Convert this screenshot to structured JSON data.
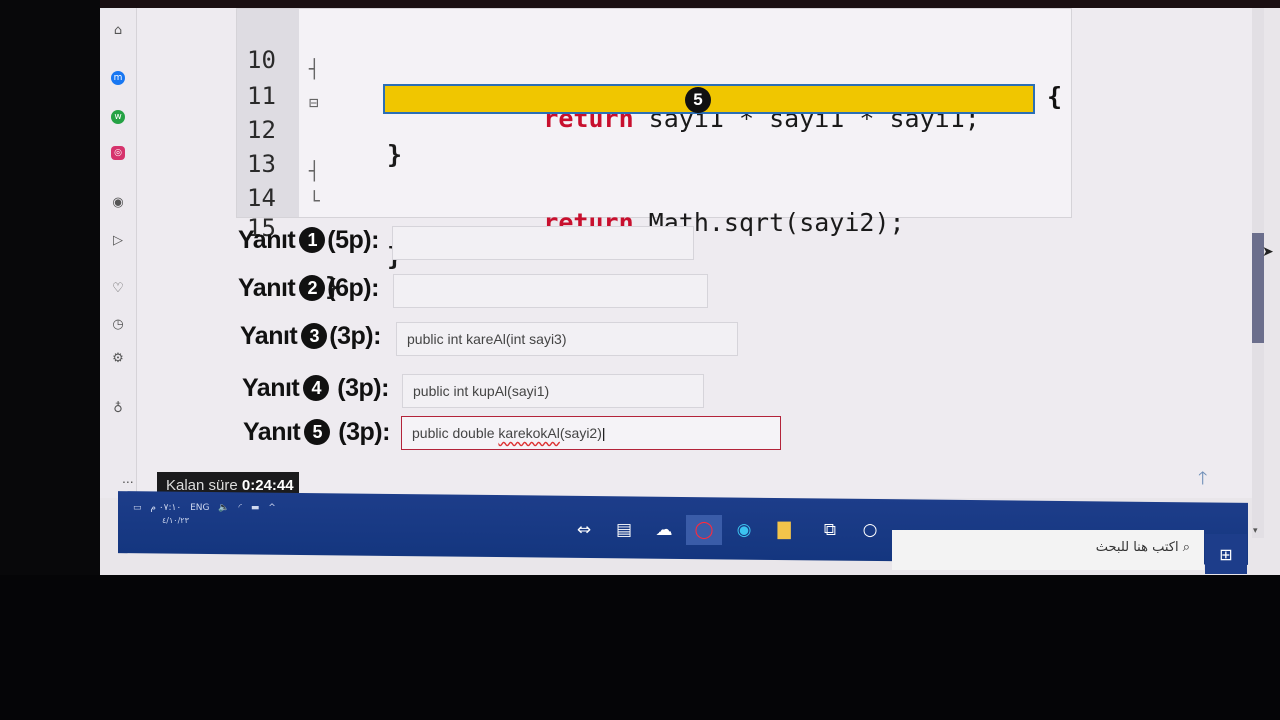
{
  "code": {
    "lines": [
      {
        "num": "10",
        "indent": "    ",
        "kw": "return",
        "rest": " sayi1 * sayi1 * sayi1;"
      },
      {
        "num": "11",
        "indent": "",
        "kw": "",
        "rest": "}"
      },
      {
        "num": "12",
        "indent": "",
        "kw": "",
        "rest": ""
      },
      {
        "num": "13",
        "indent": "    ",
        "kw": "return",
        "rest": " Math.sqrt(sayi2);"
      },
      {
        "num": "14",
        "indent": "",
        "kw": "",
        "rest": "}"
      },
      {
        "num": "15",
        "indent": "",
        "kw": "",
        "rest": "}"
      }
    ],
    "blank_number": "5",
    "open_brace": "{"
  },
  "answers": [
    {
      "prefix": "Yanıt",
      "num": "1",
      "points": "(5p):",
      "value": ""
    },
    {
      "prefix": "Yanıt",
      "num": "2",
      "points": "(6p):",
      "value": ""
    },
    {
      "prefix": "Yanıt",
      "num": "3",
      "points": "(3p):",
      "value": "public int kareAl(int sayi3)"
    },
    {
      "prefix": "Yanıt",
      "num": "4",
      "points": "(3p):",
      "value": "public int kupAl(sayi1)"
    },
    {
      "prefix": "Yanıt",
      "num": "5",
      "points": "(3p):",
      "value_a": "public double ",
      "value_b": "karekokAl",
      "value_c": "(sayi2)"
    }
  ],
  "timer": {
    "label": "Kalan süre",
    "value": "0:24:44"
  },
  "more": "...",
  "taskbar": {
    "lang": "ENG",
    "time": "٠٧:١٠ م",
    "date": "٤/١٠/٢٣",
    "search_placeholder": "اكتب هنا للبحث"
  },
  "colors": {
    "highlight": "#f0c600",
    "keyword": "#c8102e",
    "taskbar": "#1d3d8a"
  }
}
